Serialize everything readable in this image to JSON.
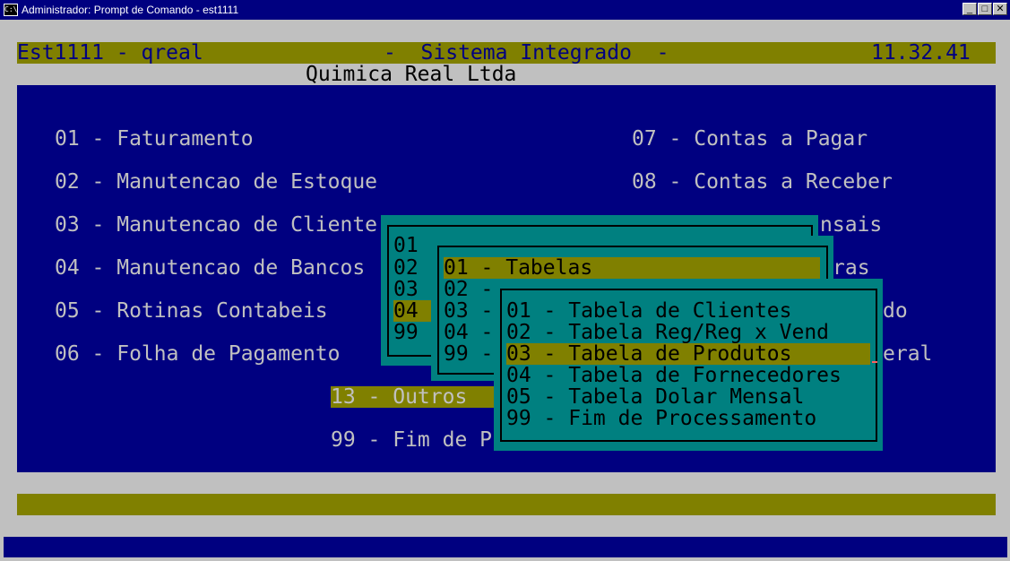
{
  "window": {
    "title": "Administrador: Prompt de Comando - est1111",
    "icon": "cmd-icon",
    "icon_text": "C:\\",
    "minimize": "_",
    "maximize": "□",
    "close": "✕"
  },
  "header": {
    "program": "Est1111 - qreal",
    "system": "-  Sistema Integrado  -",
    "time": "11.32.41",
    "company": "Quimica Real Ltda"
  },
  "main_menu": {
    "left": [
      "01 - Faturamento",
      "02 - Manutencao de Estoque",
      "03 - Manutencao de Cliente",
      "04 - Manutencao de Bancos",
      "05 - Rotinas Contabeis",
      "06 - Folha de Pagamento"
    ],
    "right": [
      "07 - Contas a Pagar",
      "08 - Contas a Receber",
      "nsais",
      "ras",
      "do",
      "eral"
    ],
    "outros": "13 - Outros ",
    "fim": "99 - Fim de P"
  },
  "submenu1": {
    "items": [
      "01",
      "02",
      "03",
      "04",
      "99"
    ]
  },
  "submenu2": {
    "selected": "01 - Tabelas",
    "items": [
      "02 -",
      "03 -",
      "04 -",
      "99 -"
    ]
  },
  "submenu3": {
    "items": [
      "01 - Tabela de Clientes",
      "02 - Tabela Reg/Reg x Vend",
      "03 - Tabela de Produtos",
      "04 - Tabela de Fornecedores",
      "05 - Tabela Dolar Mensal",
      "99 - Fim de Processamento"
    ],
    "selected_index": 2
  },
  "colors": {
    "console_bg": "#c0c0c0",
    "blue": "#000080",
    "olive": "#808000",
    "teal": "#008080"
  }
}
